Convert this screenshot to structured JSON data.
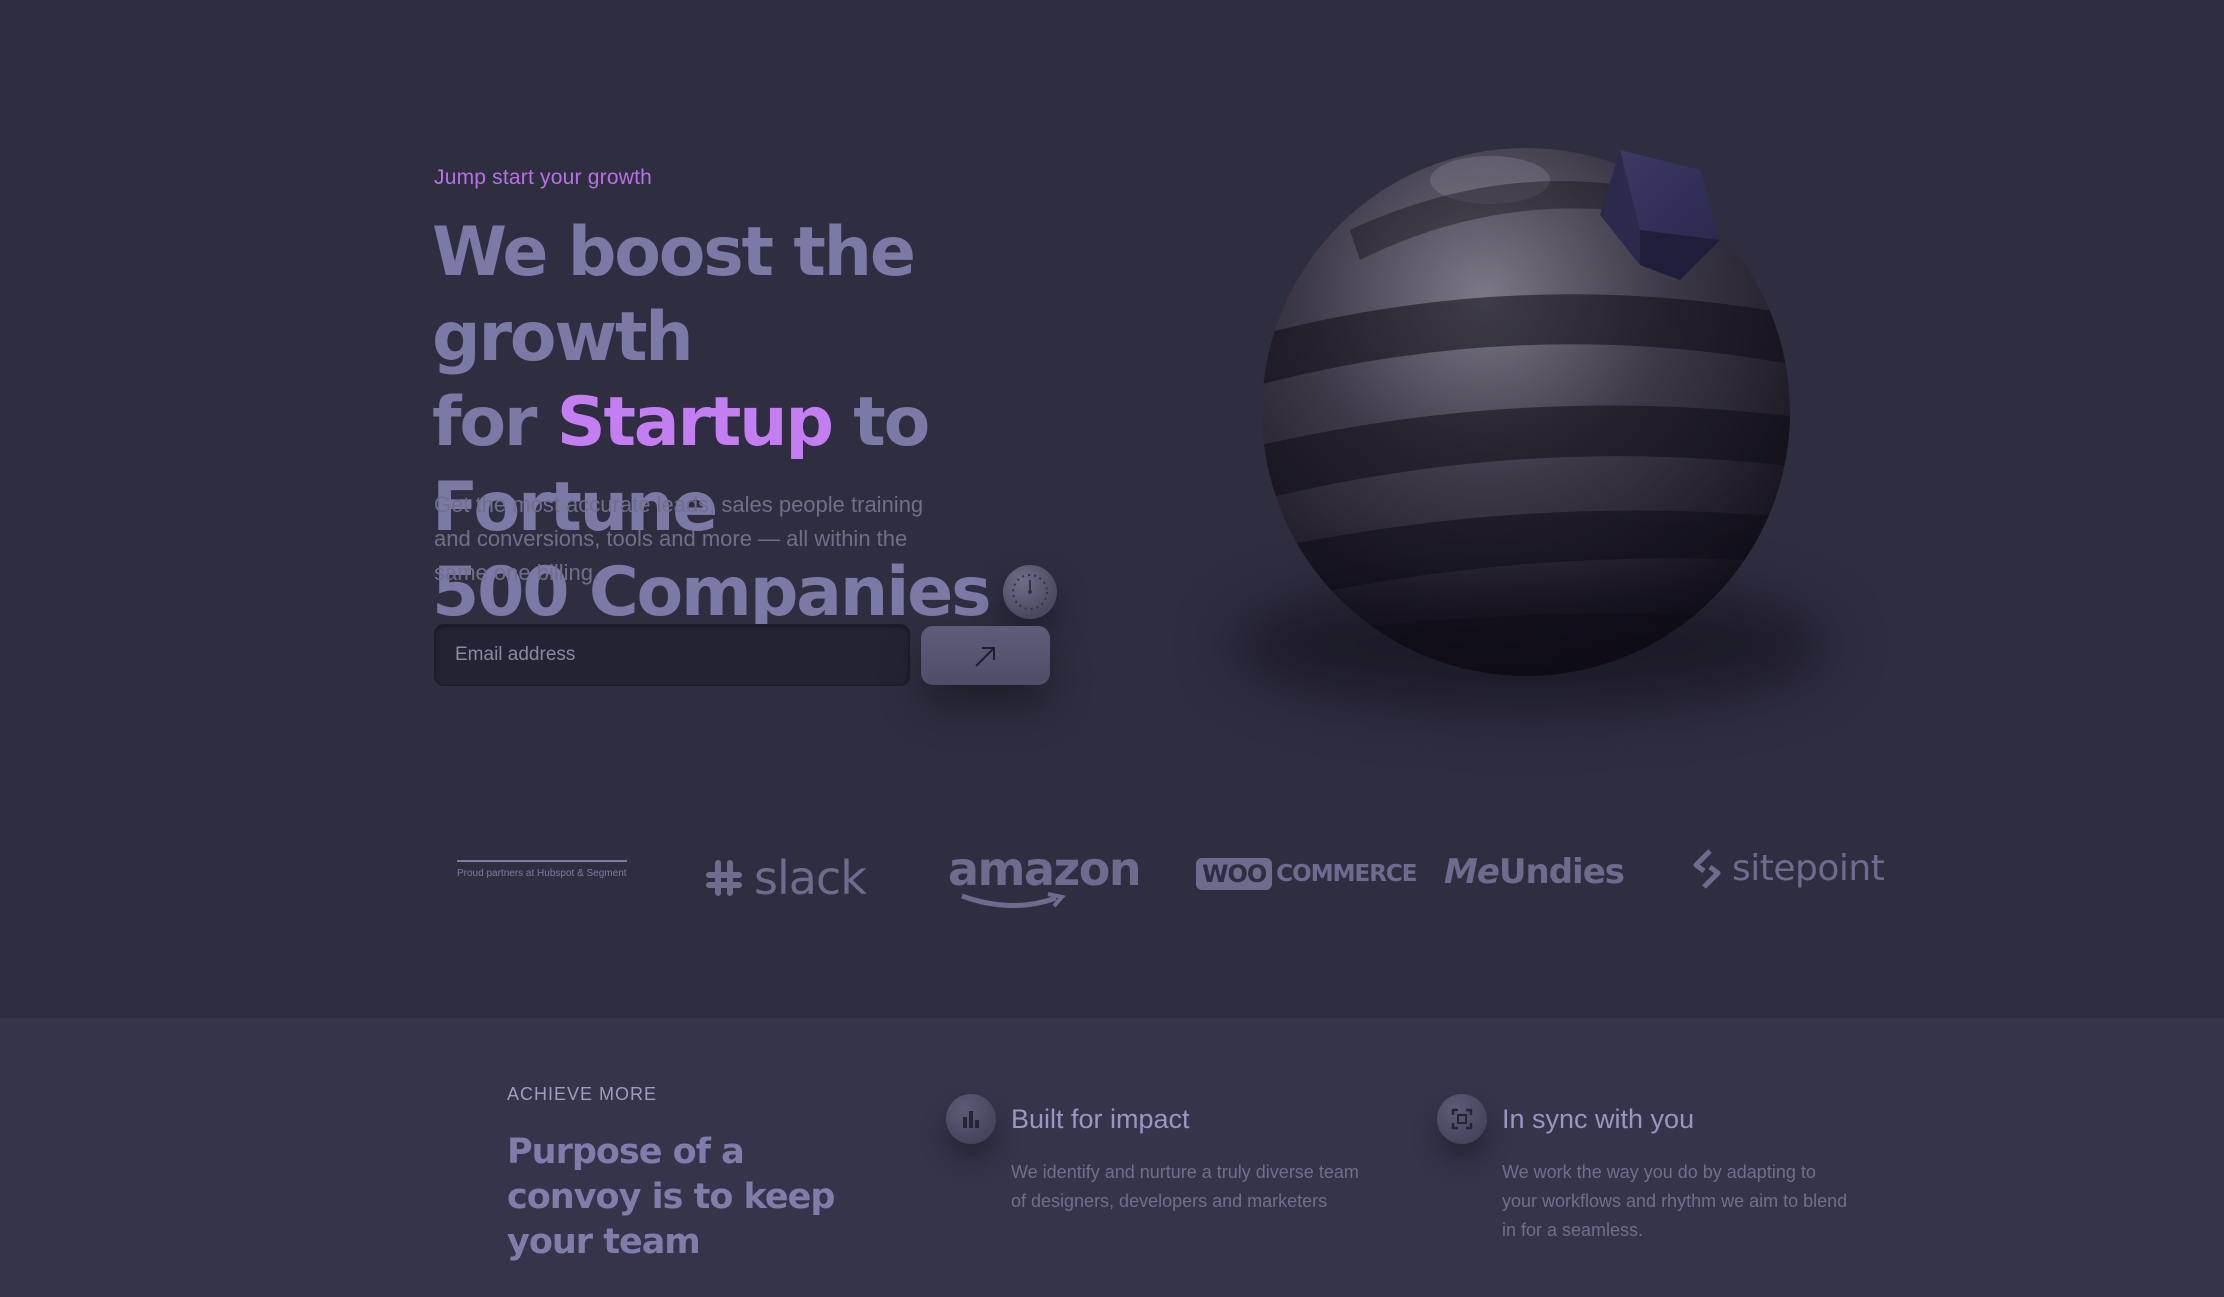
{
  "hero": {
    "eyebrow": "Jump start your growth",
    "headline_line1": "We boost the growth",
    "headline_for": "for ",
    "headline_accent": "Startup",
    "headline_rest2": " to Fortune",
    "headline_line3": "500 Companies",
    "subcopy": "Get the most accurate leads, sales people training and conversions, tools and more — all within the same one billing.",
    "email_placeholder": "Email address",
    "submit_icon": "arrow-up-right-icon",
    "accent_color": "#c37ff2"
  },
  "partners": {
    "label": "Proud partners at Hubspot & Segment",
    "logos": [
      "slack",
      "amazon",
      "WOO",
      "COMMERCE",
      "Me",
      "Undies",
      "sitepoint"
    ]
  },
  "features": {
    "overline": "ACHIEVE MORE",
    "heading": "Purpose of a convoy is to keep your team",
    "cards": [
      {
        "icon": "bar-chart-icon",
        "title": "Built for impact",
        "body": "We identify and nurture a truly diverse team of designers, developers and marketers"
      },
      {
        "icon": "sync-frame-icon",
        "title": "In sync with you",
        "body": "We work the way you do by adapting to your workflows and rhythm we aim to blend in for a seamless."
      }
    ]
  }
}
